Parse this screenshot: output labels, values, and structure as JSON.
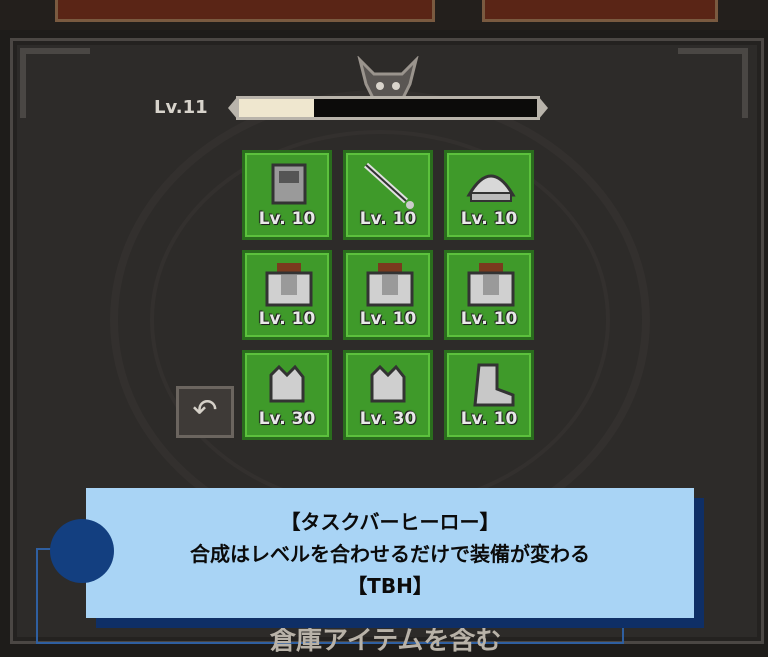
{
  "player": {
    "level_label": "Lv.11",
    "xp_progress": 0.25
  },
  "equipment": [
    {
      "icon": "armor-chest-icon",
      "level": "Lv. 10"
    },
    {
      "icon": "sword-icon",
      "level": "Lv. 10"
    },
    {
      "icon": "helmet-icon",
      "level": "Lv. 10"
    },
    {
      "icon": "body-armor-icon",
      "level": "Lv. 10"
    },
    {
      "icon": "body-armor-icon",
      "level": "Lv. 10"
    },
    {
      "icon": "body-armor-icon",
      "level": "Lv. 10"
    },
    {
      "icon": "gauntlet-icon",
      "level": "Lv. 30"
    },
    {
      "icon": "gauntlet-icon",
      "level": "Lv. 30"
    },
    {
      "icon": "boots-icon",
      "level": "Lv. 10"
    }
  ],
  "bottom_button": {
    "label": "倉庫アイテムを含む"
  },
  "caption": {
    "line1": "【タスクバーヒーロー】",
    "line2": "合成はレベルを合わせるだけで装備が変わる",
    "line3": "【TBH】"
  },
  "colors": {
    "slot_green": "#3f9a2a",
    "caption_bg": "#a9d4f5",
    "caption_shadow": "#0f2f66"
  }
}
